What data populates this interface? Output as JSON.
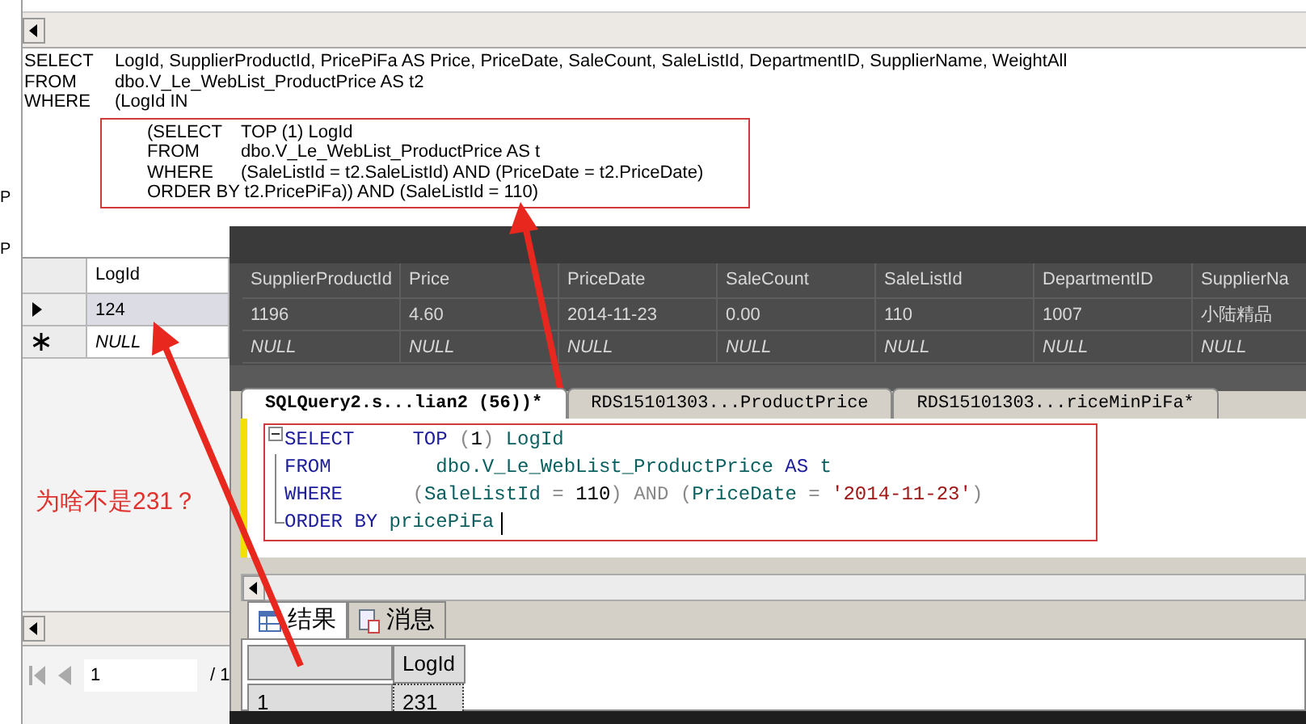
{
  "left_edge_fragments": [
    "P",
    "P"
  ],
  "query_designer": {
    "lines": [
      {
        "keyword": "SELECT",
        "text": "LogId, SupplierProductId, PricePiFa AS Price, PriceDate, SaleCount, SaleListId, DepartmentID, SupplierName, WeightAll"
      },
      {
        "keyword": "FROM",
        "text": "dbo.V_Le_WebList_ProductPrice AS t2"
      },
      {
        "keyword": "WHERE",
        "text": "(LogId IN"
      }
    ],
    "boxed_lines": [
      {
        "keyword": "(SELECT",
        "text": "TOP (1) LogId"
      },
      {
        "keyword": "FROM",
        "text": "dbo.V_Le_WebList_ProductPrice AS t"
      },
      {
        "keyword": "WHERE",
        "text": "(SaleListId = t2.SaleListId) AND (PriceDate = t2.PriceDate)"
      },
      {
        "text": "ORDER BY t2.PricePiFa)) AND (SaleListId = 110)"
      }
    ]
  },
  "result_grid": {
    "columns": [
      "LogId",
      "SupplierProductId",
      "Price",
      "PriceDate",
      "SaleCount",
      "SaleListId",
      "DepartmentID",
      "SupplierNa"
    ],
    "rows": [
      {
        "kind": "current",
        "selected": true,
        "cells": [
          "124",
          "1196",
          "4.60",
          "2014-11-23",
          "0.00",
          "110",
          "1007",
          "小陆精品"
        ]
      },
      {
        "kind": "new",
        "selected": false,
        "cells": [
          "NULL",
          "NULL",
          "NULL",
          "NULL",
          "NULL",
          "NULL",
          "NULL",
          "NULL"
        ]
      }
    ]
  },
  "pager": {
    "page": "1",
    "total": "/ 1"
  },
  "annotation": {
    "text": "为啥不是231？"
  },
  "query_window": {
    "tabs": [
      {
        "label": "SQLQuery2.s...lian2 (56))*",
        "selected": true
      },
      {
        "label": "RDS15101303...ProductPrice",
        "selected": false
      },
      {
        "label": "RDS15101303...riceMinPiFa*",
        "selected": false
      }
    ],
    "code_lines": [
      [
        {
          "kind": "keyword",
          "text": "SELECT"
        },
        {
          "kind": "keyword",
          "text": "     TOP"
        },
        {
          "kind": "operator",
          "text": " ("
        },
        {
          "kind": "number",
          "text": "1"
        },
        {
          "kind": "operator",
          "text": ") "
        },
        {
          "kind": "identifier",
          "text": "LogId"
        }
      ],
      [
        {
          "kind": "keyword",
          "text": "FROM"
        },
        {
          "kind": "identifier",
          "text": "         dbo.V_Le_WebList_ProductPrice "
        },
        {
          "kind": "keyword",
          "text": "AS"
        },
        {
          "kind": "identifier",
          "text": " t"
        }
      ],
      [
        {
          "kind": "keyword",
          "text": "WHERE"
        },
        {
          "kind": "operator",
          "text": "      ("
        },
        {
          "kind": "identifier",
          "text": "SaleListId "
        },
        {
          "kind": "operator",
          "text": "= "
        },
        {
          "kind": "number",
          "text": "110"
        },
        {
          "kind": "operator",
          "text": ") AND ("
        },
        {
          "kind": "identifier",
          "text": "PriceDate "
        },
        {
          "kind": "operator",
          "text": "= "
        },
        {
          "kind": "string",
          "text": "'2014-11-23'"
        },
        {
          "kind": "operator",
          "text": ")"
        }
      ],
      [
        {
          "kind": "keyword",
          "text": "ORDER BY"
        },
        {
          "kind": "identifier",
          "text": " pricePiFa"
        }
      ]
    ],
    "result_tabs": [
      {
        "label": "结果",
        "selected": true
      },
      {
        "label": "消息",
        "selected": false
      }
    ],
    "results": {
      "columns": [
        "LogId"
      ],
      "rows": [
        {
          "row_number": "1",
          "cells": [
            "231"
          ]
        }
      ]
    }
  }
}
